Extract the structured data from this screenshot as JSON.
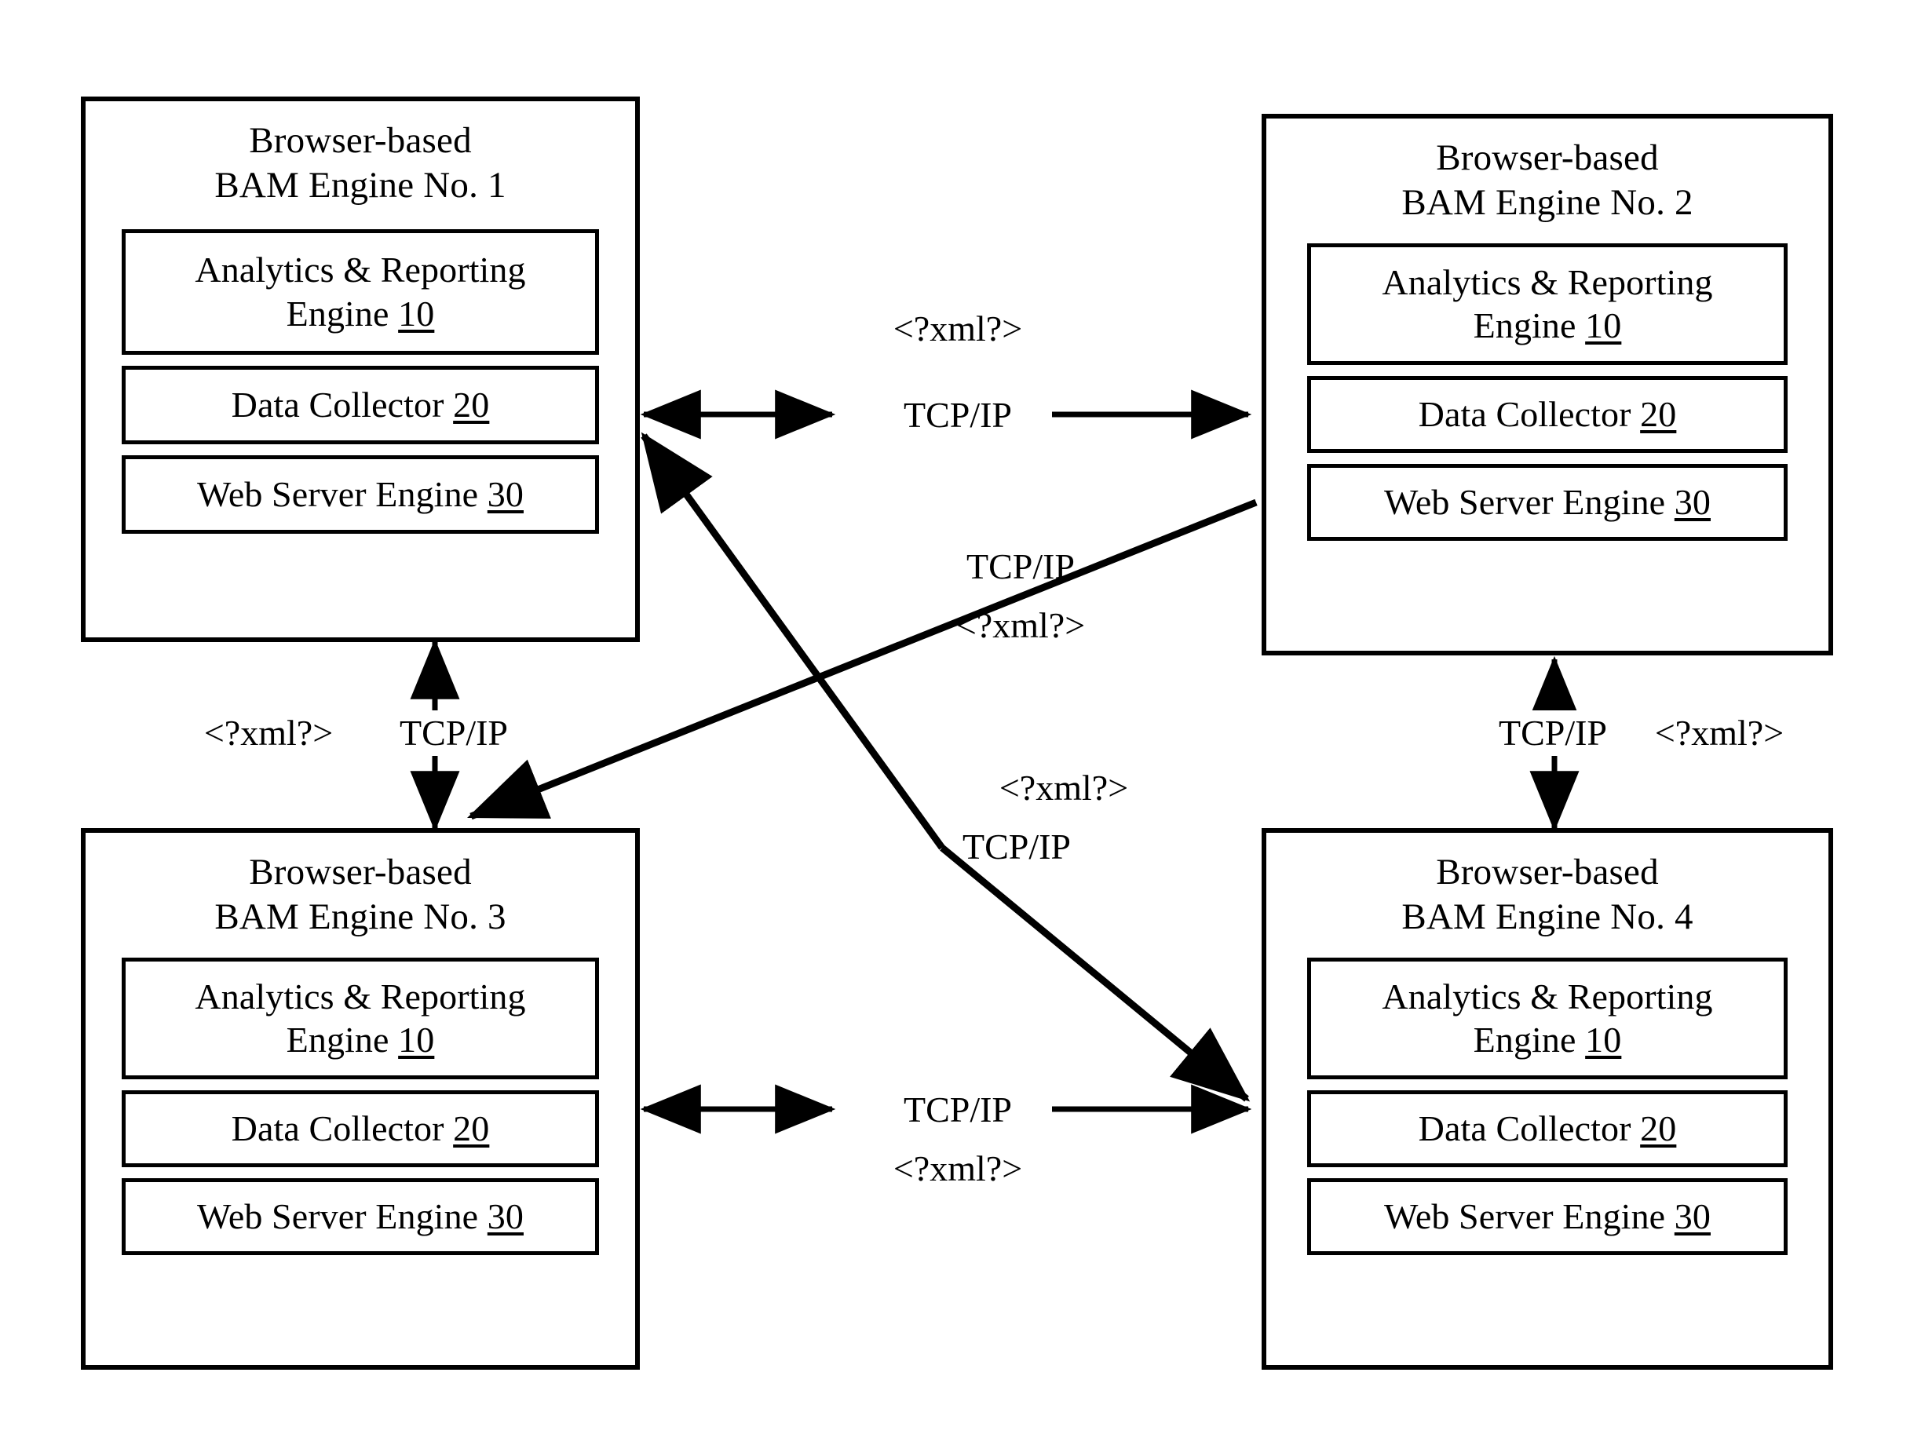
{
  "figure": {
    "type": "block-diagram",
    "background_color": "#ffffff",
    "stroke_color": "#000000"
  },
  "engines": [
    {
      "id": "engine-1",
      "title": "Browser-based\nBAM Engine No. 1",
      "components": [
        {
          "label": "Analytics & Reporting\nEngine ",
          "ref": "10"
        },
        {
          "label": "Data Collector ",
          "ref": "20"
        },
        {
          "label": "Web Server Engine ",
          "ref": "30"
        }
      ]
    },
    {
      "id": "engine-2",
      "title": "Browser-based\nBAM Engine No. 2",
      "components": [
        {
          "label": "Analytics & Reporting\nEngine ",
          "ref": "10"
        },
        {
          "label": "Data Collector ",
          "ref": "20"
        },
        {
          "label": "Web Server Engine ",
          "ref": "30"
        }
      ]
    },
    {
      "id": "engine-3",
      "title": "Browser-based\nBAM Engine No. 3",
      "components": [
        {
          "label": "Analytics & Reporting\nEngine ",
          "ref": "10"
        },
        {
          "label": "Data Collector ",
          "ref": "20"
        },
        {
          "label": "Web Server Engine ",
          "ref": "30"
        }
      ]
    },
    {
      "id": "engine-4",
      "title": "Browser-based\nBAM Engine No. 4",
      "components": [
        {
          "label": "Analytics & Reporting\nEngine ",
          "ref": "10"
        },
        {
          "label": "Data Collector ",
          "ref": "20"
        },
        {
          "label": "Web Server Engine ",
          "ref": "30"
        }
      ]
    }
  ],
  "connectors": {
    "top_horizontal": {
      "between": "engine-1 <-> engine-2",
      "xml_label": "<?xml?>",
      "protocol_label": "TCP/IP"
    },
    "left_vertical": {
      "between": "engine-1 <-> engine-3",
      "xml_label": "<?xml?>",
      "protocol_label": "TCP/IP"
    },
    "right_vertical": {
      "between": "engine-2 <-> engine-4",
      "protocol_label": "TCP/IP",
      "xml_label": "<?xml?>"
    },
    "bottom_horizontal": {
      "between": "engine-3 <-> engine-4",
      "protocol_label": "TCP/IP",
      "xml_label": "<?xml?>"
    },
    "diagonal_2_3": {
      "between": "engine-2 <-> engine-3",
      "protocol_label": "TCP/IP",
      "xml_label": "<?xml?>"
    },
    "diagonal_1_4": {
      "between": "engine-1 <-> engine-4",
      "xml_label": "<?xml?>",
      "protocol_label": "TCP/IP"
    }
  }
}
